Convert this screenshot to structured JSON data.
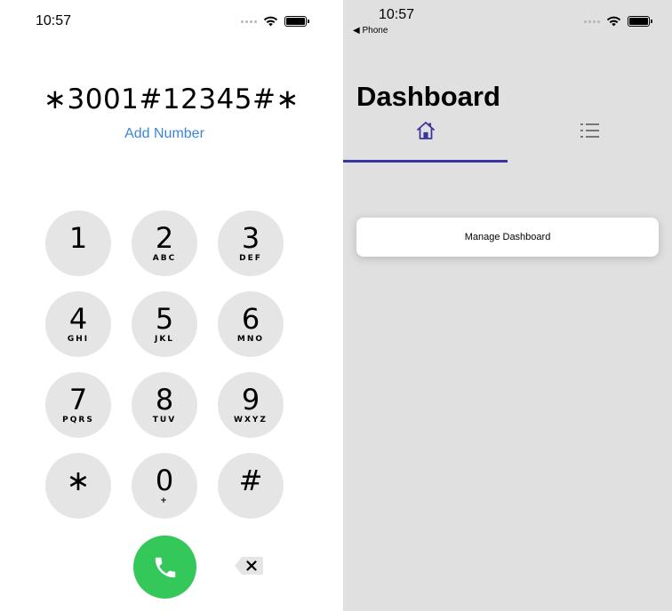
{
  "dialer": {
    "status": {
      "time": "10:57"
    },
    "dialed_number": "∗3001#12345#∗",
    "add_number_label": "Add Number",
    "keys": [
      {
        "digit": "1",
        "letters": ""
      },
      {
        "digit": "2",
        "letters": "ABC"
      },
      {
        "digit": "3",
        "letters": "DEF"
      },
      {
        "digit": "4",
        "letters": "GHI"
      },
      {
        "digit": "5",
        "letters": "JKL"
      },
      {
        "digit": "6",
        "letters": "MNO"
      },
      {
        "digit": "7",
        "letters": "PQRS"
      },
      {
        "digit": "8",
        "letters": "TUV"
      },
      {
        "digit": "9",
        "letters": "WXYZ"
      },
      {
        "digit": "∗",
        "letters": ""
      },
      {
        "digit": "0",
        "letters": "+"
      },
      {
        "digit": "#",
        "letters": ""
      }
    ],
    "call_icon": "phone-icon",
    "delete_icon": "backspace-icon",
    "colors": {
      "key_bg": "#e5e5e5",
      "call_green": "#34c759",
      "link_blue": "#3b86d8"
    }
  },
  "dashboard": {
    "status": {
      "time": "10:57",
      "back_label": "◀ Phone"
    },
    "title": "Dashboard",
    "tabs": [
      {
        "icon": "home-icon",
        "selected": true
      },
      {
        "icon": "list-icon",
        "selected": false
      }
    ],
    "card_label": "Manage Dashboard",
    "colors": {
      "background": "#e0e0e0",
      "accent": "#3a34a0"
    }
  }
}
